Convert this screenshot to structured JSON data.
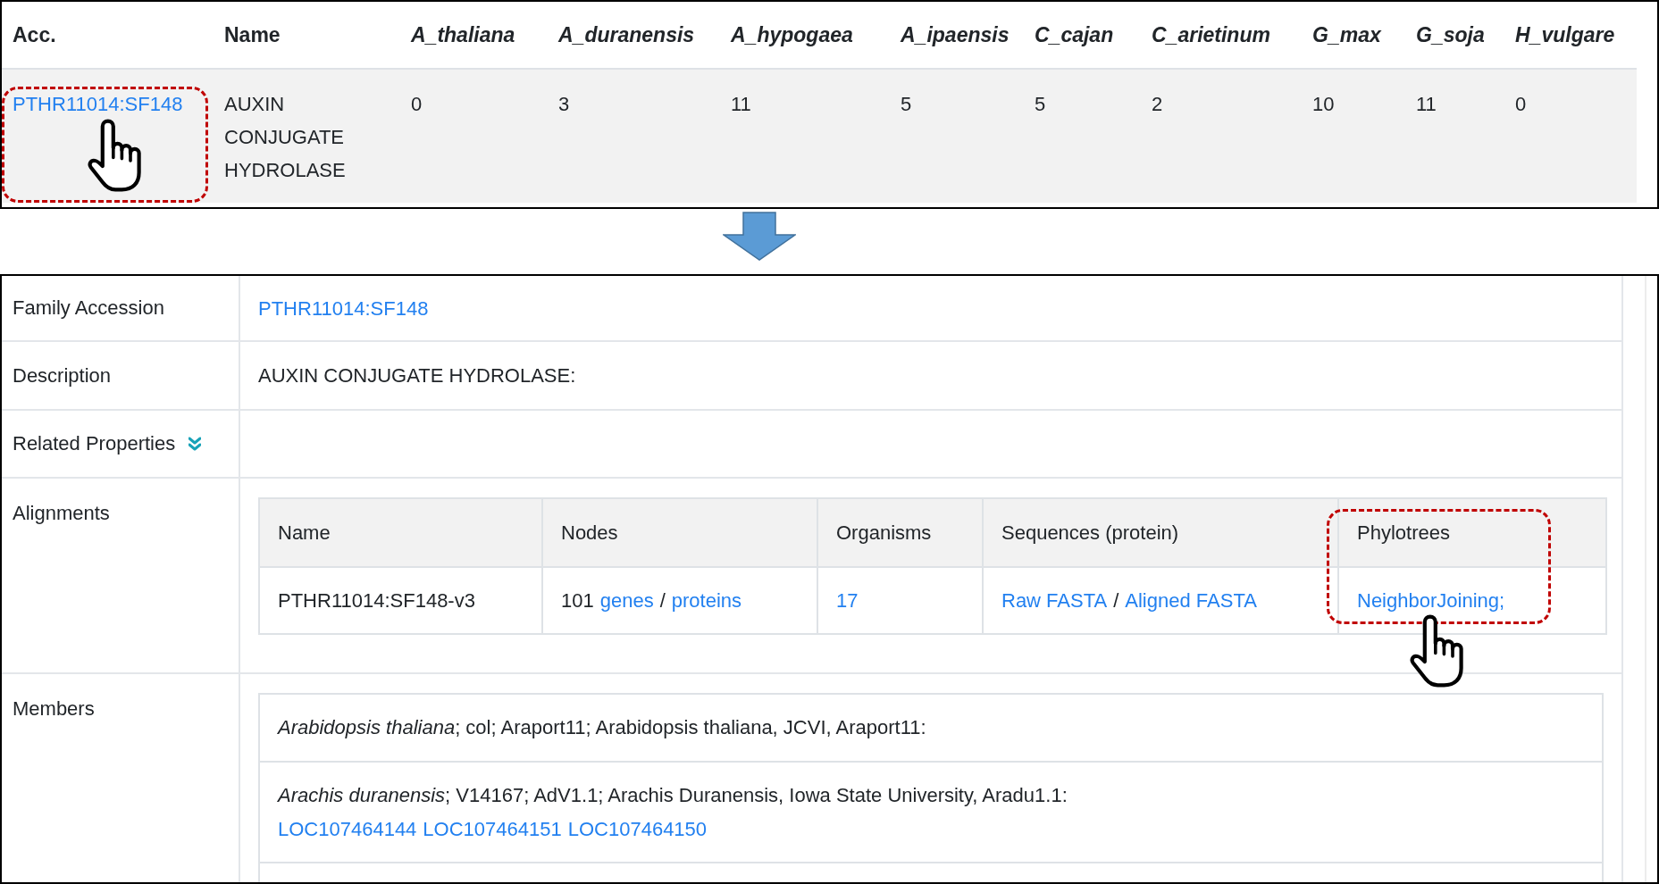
{
  "source_table": {
    "columns": [
      {
        "label": "Acc.",
        "italic": false
      },
      {
        "label": "Name",
        "italic": false
      },
      {
        "label": "A_thaliana",
        "italic": true
      },
      {
        "label": "A_duranensis",
        "italic": true
      },
      {
        "label": "A_hypogaea",
        "italic": true
      },
      {
        "label": "A_ipaensis",
        "italic": true
      },
      {
        "label": "C_cajan",
        "italic": true
      },
      {
        "label": "C_arietinum",
        "italic": true
      },
      {
        "label": "G_max",
        "italic": true
      },
      {
        "label": "G_soja",
        "italic": true
      },
      {
        "label": "H_vulgare",
        "italic": true
      }
    ],
    "rows": [
      {
        "cells": [
          {
            "kind": "link",
            "text": "PTHR11014:SF148"
          },
          {
            "kind": "text",
            "text": "AUXIN CONJUGATE HYDROLASE"
          },
          {
            "kind": "text",
            "text": "0"
          },
          {
            "kind": "text",
            "text": "3"
          },
          {
            "kind": "text",
            "text": "11"
          },
          {
            "kind": "text",
            "text": "5"
          },
          {
            "kind": "text",
            "text": "5"
          },
          {
            "kind": "text",
            "text": "2"
          },
          {
            "kind": "text",
            "text": "10"
          },
          {
            "kind": "text",
            "text": "11"
          },
          {
            "kind": "text",
            "text": "0"
          }
        ]
      }
    ]
  },
  "details": {
    "rows": [
      {
        "kind": "link",
        "label": "Family Accession",
        "value": "PTHR11014:SF148"
      },
      {
        "kind": "text",
        "label": "Description",
        "value": "AUXIN CONJUGATE HYDROLASE:"
      },
      {
        "kind": "toggle",
        "label": "Related Properties",
        "expanded": false
      },
      {
        "kind": "alignments",
        "label": "Alignments",
        "table": {
          "columns": [
            "Name",
            "Nodes",
            "Organisms",
            "Sequences (protein)",
            "Phylotrees"
          ],
          "rows": [
            {
              "cells": [
                [
                  {
                    "kind": "text",
                    "text": "PTHR11014:SF148-v3"
                  }
                ],
                [
                  {
                    "kind": "text",
                    "text": "101"
                  },
                  {
                    "kind": "link",
                    "text": "genes"
                  },
                  {
                    "kind": "text",
                    "text": "/"
                  },
                  {
                    "kind": "link",
                    "text": "proteins"
                  }
                ],
                [
                  {
                    "kind": "link",
                    "text": "17"
                  }
                ],
                [
                  {
                    "kind": "link",
                    "text": "Raw FASTA"
                  },
                  {
                    "kind": "text",
                    "text": "/"
                  },
                  {
                    "kind": "link",
                    "text": "Aligned FASTA"
                  }
                ],
                [
                  {
                    "kind": "link",
                    "text": "NeighborJoining;"
                  }
                ]
              ]
            }
          ]
        }
      },
      {
        "kind": "members",
        "label": "Members",
        "entries": [
          {
            "text": "*Arabidopsis thaliana*; col; Araport11; Arabidopsis thaliana, JCVI, Araport11:"
          },
          {
            "text": "*Arachis duranensis*; V14167; AdV1.1; Arachis Duranensis, Iowa State University, Aradu1.1:",
            "genes": [
              "LOC107464144",
              "LOC107464151",
              "LOC107464150"
            ]
          }
        ]
      }
    ]
  }
}
